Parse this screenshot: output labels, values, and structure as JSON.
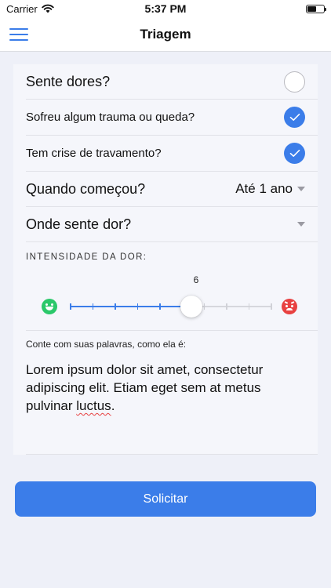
{
  "status_bar": {
    "carrier": "Carrier",
    "time": "5:37 PM",
    "wifi_icon": "wifi-icon",
    "battery_icon": "battery-icon"
  },
  "nav": {
    "title": "Triagem",
    "menu_icon": "hamburger-menu-icon"
  },
  "form": {
    "questions": [
      {
        "label": "Sente dores?",
        "checked": false
      },
      {
        "label": "Sofreu algum trauma ou queda?",
        "checked": true
      },
      {
        "label": "Tem crise de travamento?",
        "checked": true
      }
    ],
    "when_started": {
      "label": "Quando começou?",
      "value": "Até 1 ano"
    },
    "where_pain": {
      "label": "Onde sente dor?",
      "value": ""
    },
    "intensity": {
      "label": "INTENSIDADE DA DOR:",
      "value": 6,
      "min": 0,
      "max": 10,
      "value_text": "6",
      "low_icon": "happy-face-icon",
      "high_icon": "angry-face-icon"
    },
    "description": {
      "prompt": "Conte com suas palavras, como ela é:",
      "text_main": "Lorem ipsum dolor sit amet, consectetur adipiscing elit. Etiam eget sem at metus pulvinar ",
      "text_misspelled": "luctus",
      "text_end": "."
    }
  },
  "actions": {
    "submit_label": "Solicitar"
  },
  "colors": {
    "accent": "#3b7de9",
    "happy": "#2bc86a",
    "angry": "#e84141",
    "background": "#eef0f8"
  }
}
